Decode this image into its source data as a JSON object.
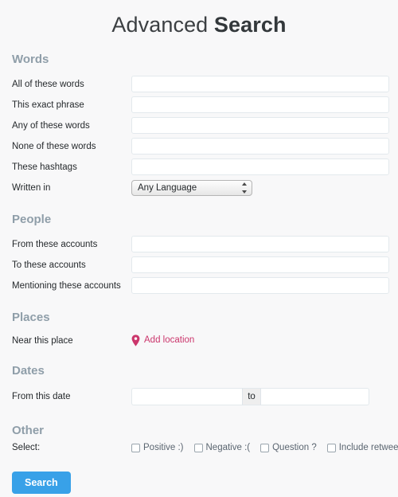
{
  "title": {
    "light": "Advanced ",
    "bold": "Search"
  },
  "sections": {
    "words": {
      "heading": "Words",
      "rows": [
        {
          "label": "All of these words",
          "value": "",
          "placeholder": ""
        },
        {
          "label": "This exact phrase",
          "value": "",
          "placeholder": ""
        },
        {
          "label": "Any of these words",
          "value": "",
          "placeholder": ""
        },
        {
          "label": "None of these words",
          "value": "",
          "placeholder": ""
        },
        {
          "label": "These hashtags",
          "value": "",
          "placeholder": ""
        }
      ],
      "language": {
        "label": "Written in",
        "selected": "Any Language",
        "icon": "chevron-updown-icon"
      }
    },
    "people": {
      "heading": "People",
      "rows": [
        {
          "label": "From these accounts",
          "value": "",
          "placeholder": ""
        },
        {
          "label": "To these accounts",
          "value": "",
          "placeholder": ""
        },
        {
          "label": "Mentioning these accounts",
          "value": "",
          "placeholder": ""
        }
      ]
    },
    "places": {
      "heading": "Places",
      "label": "Near this place",
      "link_text": "Add location",
      "link_icon": "map-pin-icon",
      "link_color": "#cb366c"
    },
    "dates": {
      "heading": "Dates",
      "label": "From this date",
      "from_value": "",
      "separator": "to",
      "to_value": ""
    },
    "other": {
      "heading": "Other",
      "label": "Select:",
      "checkboxes": [
        {
          "label": "Positive :)",
          "checked": false
        },
        {
          "label": "Negative :(",
          "checked": false
        },
        {
          "label": "Question ?",
          "checked": false
        },
        {
          "label": "Include retweets",
          "checked": false
        }
      ]
    }
  },
  "submit": {
    "label": "Search",
    "color": "#38a1e8"
  }
}
